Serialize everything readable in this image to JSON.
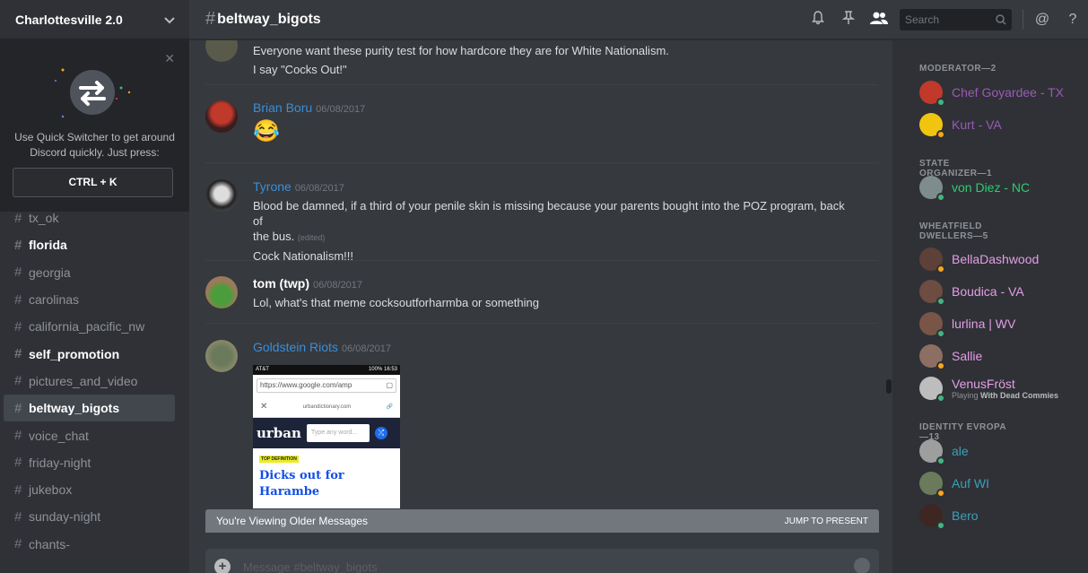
{
  "guild": {
    "name": "Charlottesville 2.0"
  },
  "quick_switcher": {
    "line1": "Use Quick Switcher to get around",
    "line2": "Discord quickly. Just press:",
    "shortcut": "CTRL + K"
  },
  "channels": [
    {
      "name": "tx_ok",
      "style": "dim"
    },
    {
      "name": "florida",
      "style": "bold"
    },
    {
      "name": "georgia",
      "style": "dim"
    },
    {
      "name": "carolinas",
      "style": "dim"
    },
    {
      "name": "california_pacific_nw",
      "style": "dim"
    },
    {
      "name": "self_promotion",
      "style": "bold"
    },
    {
      "name": "pictures_and_video",
      "style": "dim"
    },
    {
      "name": "beltway_bigots",
      "style": "active"
    },
    {
      "name": "voice_chat",
      "style": "dim"
    },
    {
      "name": "friday-night",
      "style": "dim"
    },
    {
      "name": "jukebox",
      "style": "dim"
    },
    {
      "name": "sunday-night",
      "style": "dim"
    },
    {
      "name": "chants-",
      "style": "dim"
    }
  ],
  "header": {
    "channel": "beltway_bigots",
    "search_placeholder": "Search"
  },
  "messages": [
    {
      "lines": [
        "Everyone want these purity test for how hardcore they are for White Nationalism.",
        "I say \"Cocks Out!\""
      ]
    },
    {
      "author": "Brian Boru",
      "color": "#3b8ed6",
      "time": "06/08/2017",
      "emoji": "😂"
    },
    {
      "author": "Tyrone",
      "color": "#3b8ed6",
      "time": "06/08/2017",
      "lines": [
        "Blood be damned, if a third of your penile skin is missing because your parents bought into the POZ program, back of",
        "the bus.",
        "Cock Nationalism!!!"
      ],
      "edited": "(edited)"
    },
    {
      "author": "tom (twp)",
      "color": "#ffffff",
      "time": "06/08/2017",
      "lines": [
        "Lol, what's that meme cocksoutforharmba or something"
      ]
    },
    {
      "author": "Goldstein Riots",
      "color": "#3b8ed6",
      "time": "06/08/2017"
    }
  ],
  "attachment": {
    "carrier": "AT&T",
    "battery": "100%",
    "clock": "16:53",
    "url": "https://www.google.com/amp",
    "site": "urbandictionary.com",
    "logo": "urban",
    "search_placeholder": "Type any word...",
    "tag": "TOP DEFINITION",
    "word_line1": "Dicks out for",
    "word_line2": "Harambe"
  },
  "older_banner": {
    "text": "You're Viewing Older Messages",
    "action": "JUMP TO PRESENT"
  },
  "composer": {
    "placeholder": "Message #beltway_bigots"
  },
  "member_groups": [
    {
      "title": "MODERATOR—2",
      "members": [
        {
          "name": "Chef Goyardee - TX",
          "color": "#9b59b6",
          "status": "online"
        },
        {
          "name": "Kurt - VA",
          "color": "#9b59b6",
          "status": "idle"
        }
      ]
    },
    {
      "title": "STATE ORGANIZER—1",
      "members": [
        {
          "name": "von Diez - NC",
          "color": "#2ecc71",
          "status": "online"
        }
      ]
    },
    {
      "title": "WHEATFIELD DWELLERS—5",
      "members": [
        {
          "name": "BellaDashwood",
          "color": "#e59ee6",
          "status": "idle"
        },
        {
          "name": "Boudica - VA",
          "color": "#e59ee6",
          "status": "online"
        },
        {
          "name": "lurlina | WV",
          "color": "#e59ee6",
          "status": "online"
        },
        {
          "name": "Sallie",
          "color": "#e59ee6",
          "status": "idle"
        },
        {
          "name": "VenusFröst",
          "color": "#e59ee6",
          "status": "online",
          "game_prefix": "Playing",
          "game": "With Dead Commies"
        }
      ]
    },
    {
      "title": "IDENTITY EVROPA—13",
      "members": [
        {
          "name": "ale",
          "color": "#3aa0b8",
          "status": "online"
        },
        {
          "name": "Auf WI",
          "color": "#3aa0b8",
          "status": "idle"
        },
        {
          "name": "Bero",
          "color": "#3aa0b8",
          "status": "online"
        }
      ]
    }
  ]
}
